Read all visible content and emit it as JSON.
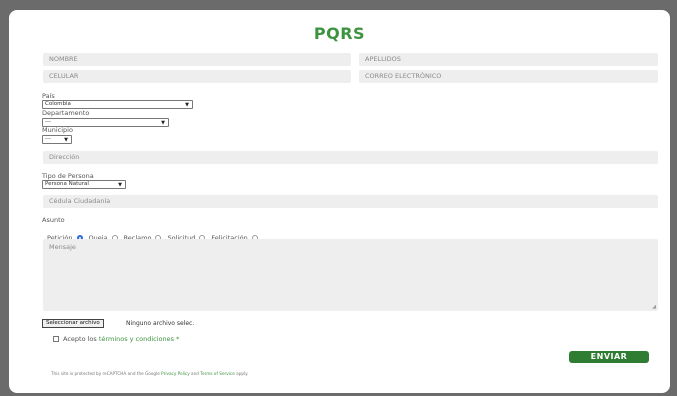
{
  "form": {
    "title": "PQRS",
    "nombre_placeholder": "NOMBRE",
    "apellidos_placeholder": "APELLIDOS",
    "celular_placeholder": "CELULAR",
    "correo_placeholder": "CORREO ELECTRÓNICO",
    "pais_label": "País",
    "pais_value": "Colombia",
    "departamento_label": "Departamento",
    "departamento_value": "---",
    "municipio_label": "Municipio",
    "municipio_value": "---",
    "direccion_placeholder": "Dirección",
    "tipo_persona_label": "Tipo de Persona",
    "tipo_persona_value": "Persona Natural",
    "cedula_placeholder": "Cédula Ciudadanía",
    "asunto_label": "Asunto",
    "asunto_options": [
      "Petición",
      "Queja",
      "Reclamo",
      "Solicitud",
      "Felicitación"
    ],
    "asunto_selected": "Petición",
    "mensaje_placeholder": "Mensaje",
    "file_button": "Seleccionar archivo",
    "file_status": "Ninguno archivo selec.",
    "terms_prefix": "Acepto los",
    "terms_link": "términos y condiciones",
    "terms_required": "*",
    "submit_label": "ENVIAR",
    "recaptcha_prefix": "This site is protected by reCAPTCHA and the Google",
    "privacy_link": "Privacy Policy",
    "and_text": "and",
    "terms_service_link": "Terms of Service",
    "apply_text": "apply."
  }
}
